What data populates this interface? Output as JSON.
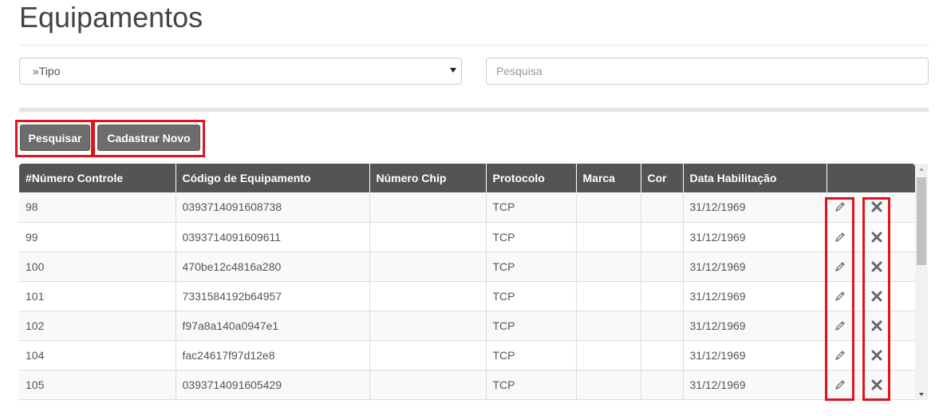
{
  "page": {
    "title": "Equipamentos"
  },
  "filters": {
    "type_select_value": "»Tipo",
    "search_placeholder": "Pesquisa"
  },
  "buttons": {
    "search_label": "Pesquisar",
    "new_label": "Cadastrar Novo"
  },
  "table": {
    "columns": [
      "#Número Controle",
      "Código de Equipamento",
      "Número Chip",
      "Protocolo",
      "Marca",
      "Cor",
      "Data Habilitação",
      ""
    ],
    "rows": [
      {
        "controle": "98",
        "codigo": "0393714091608738",
        "chip": "",
        "protocolo": "TCP",
        "marca": "",
        "cor": "",
        "data": "31/12/1969"
      },
      {
        "controle": "99",
        "codigo": "0393714091609611",
        "chip": "",
        "protocolo": "TCP",
        "marca": "",
        "cor": "",
        "data": "31/12/1969"
      },
      {
        "controle": "100",
        "codigo": "470be12c4816a280",
        "chip": "",
        "protocolo": "TCP",
        "marca": "",
        "cor": "",
        "data": "31/12/1969"
      },
      {
        "controle": "101",
        "codigo": "7331584192b64957",
        "chip": "",
        "protocolo": "TCP",
        "marca": "",
        "cor": "",
        "data": "31/12/1969"
      },
      {
        "controle": "102",
        "codigo": "f97a8a140a0947e1",
        "chip": "",
        "protocolo": "TCP",
        "marca": "",
        "cor": "",
        "data": "31/12/1969"
      },
      {
        "controle": "104",
        "codigo": "fac24617f97d12e8",
        "chip": "",
        "protocolo": "TCP",
        "marca": "",
        "cor": "",
        "data": "31/12/1969"
      },
      {
        "controle": "105",
        "codigo": "0393714091605429",
        "chip": "",
        "protocolo": "TCP",
        "marca": "",
        "cor": "",
        "data": "31/12/1969"
      }
    ],
    "row_icons": {
      "edit": "pencil-icon",
      "delete": "close-icon"
    }
  },
  "colors": {
    "header_bg": "#545454",
    "button_bg": "#6d6d6d",
    "highlight": "#e0141e"
  }
}
